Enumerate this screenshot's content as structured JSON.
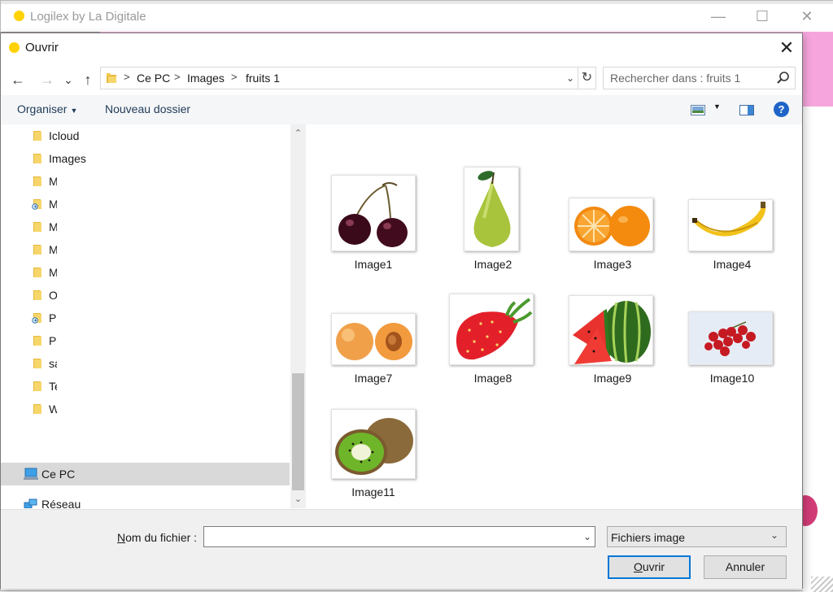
{
  "app": {
    "title": "Logilex by La Digitale",
    "minimize": "—",
    "maximize": "☐",
    "close": "✕"
  },
  "dialog": {
    "title": "Ouvrir",
    "close": "✕"
  },
  "address": {
    "crumbs": [
      "Ce PC",
      "Images",
      "fruits 1"
    ],
    "separator": ">",
    "back": "←",
    "forward": "→",
    "recent": "⌄",
    "up": "↑",
    "refresh": "↻",
    "dropdown": "⌄"
  },
  "search": {
    "placeholder": "Rechercher dans : fruits 1"
  },
  "toolbar": {
    "organize": "Organiser",
    "new_folder": "Nouveau dossier",
    "help": "?"
  },
  "navpane": {
    "items": [
      {
        "label": "Icloud",
        "icon": "folder-icon"
      },
      {
        "label": "Images",
        "icon": "folder-icon"
      },
      {
        "label": "M",
        "icon": "folder-icon"
      },
      {
        "label": "M",
        "icon": "linked-folder-icon"
      },
      {
        "label": "M",
        "icon": "folder-icon"
      },
      {
        "label": "M",
        "icon": "folder-icon"
      },
      {
        "label": "M",
        "icon": "folder-icon"
      },
      {
        "label": "O",
        "icon": "folder-icon"
      },
      {
        "label": "P:",
        "icon": "linked-folder-icon"
      },
      {
        "label": "Pi",
        "icon": "folder-icon"
      },
      {
        "label": "sa",
        "icon": "folder-icon"
      },
      {
        "label": "Te",
        "icon": "folder-icon"
      },
      {
        "label": "W",
        "icon": "folder-icon"
      }
    ],
    "this_pc": "Ce PC",
    "network": "Réseau",
    "scroll_up": "⌃",
    "scroll_down": "⌄"
  },
  "files": [
    {
      "name": "Image1",
      "icon": "cherries-thumbnail"
    },
    {
      "name": "Image2",
      "icon": "pear-thumbnail"
    },
    {
      "name": "Image3",
      "icon": "oranges-thumbnail"
    },
    {
      "name": "Image4",
      "icon": "banana-thumbnail"
    },
    {
      "name": "Image7",
      "icon": "apricots-thumbnail"
    },
    {
      "name": "Image8",
      "icon": "strawberry-thumbnail"
    },
    {
      "name": "Image9",
      "icon": "watermelon-thumbnail"
    },
    {
      "name": "Image10",
      "icon": "redcurrants-thumbnail"
    },
    {
      "name": "Image11",
      "icon": "kiwi-thumbnail"
    }
  ],
  "bottom": {
    "filename_label_underlined": "N",
    "filename_label_rest": "om du fichier :",
    "filename_value": "",
    "filename_dropdown": "⌄",
    "filetype": "Fichiers image",
    "filetype_arrow": "⌄",
    "open_underlined": "O",
    "open_rest": "uvrir",
    "cancel": "Annuler"
  },
  "colors": {
    "accent": "#0078d7",
    "pink_banner": "#f6a6dd",
    "app_dot": "#ffd200"
  }
}
